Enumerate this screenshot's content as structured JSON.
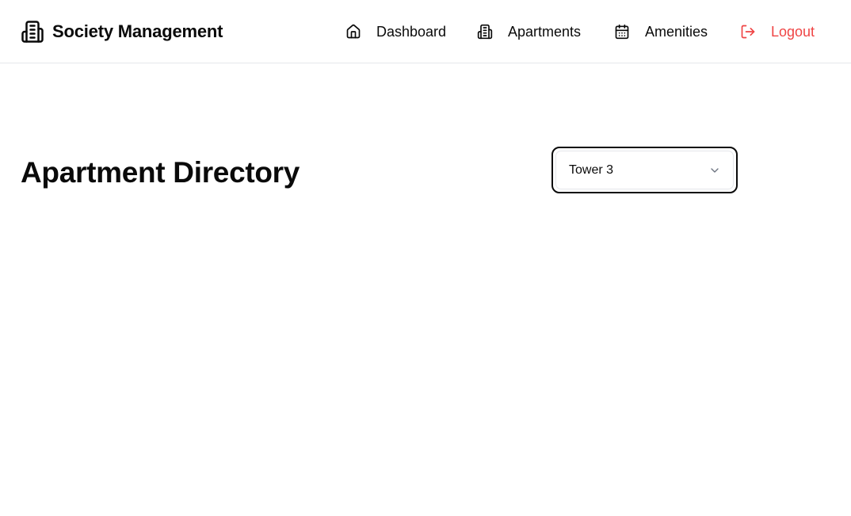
{
  "brand": {
    "title": "Society Management",
    "icon": "building-icon"
  },
  "nav": {
    "items": [
      {
        "label": "Dashboard",
        "icon": "home-icon"
      },
      {
        "label": "Apartments",
        "icon": "building-icon"
      },
      {
        "label": "Amenities",
        "icon": "calendar-icon"
      }
    ],
    "logout": {
      "label": "Logout",
      "icon": "logout-icon",
      "color": "#ef4444"
    }
  },
  "main": {
    "title": "Apartment Directory",
    "tower_select": {
      "value": "Tower 3",
      "icon": "chevron-down-icon"
    }
  }
}
